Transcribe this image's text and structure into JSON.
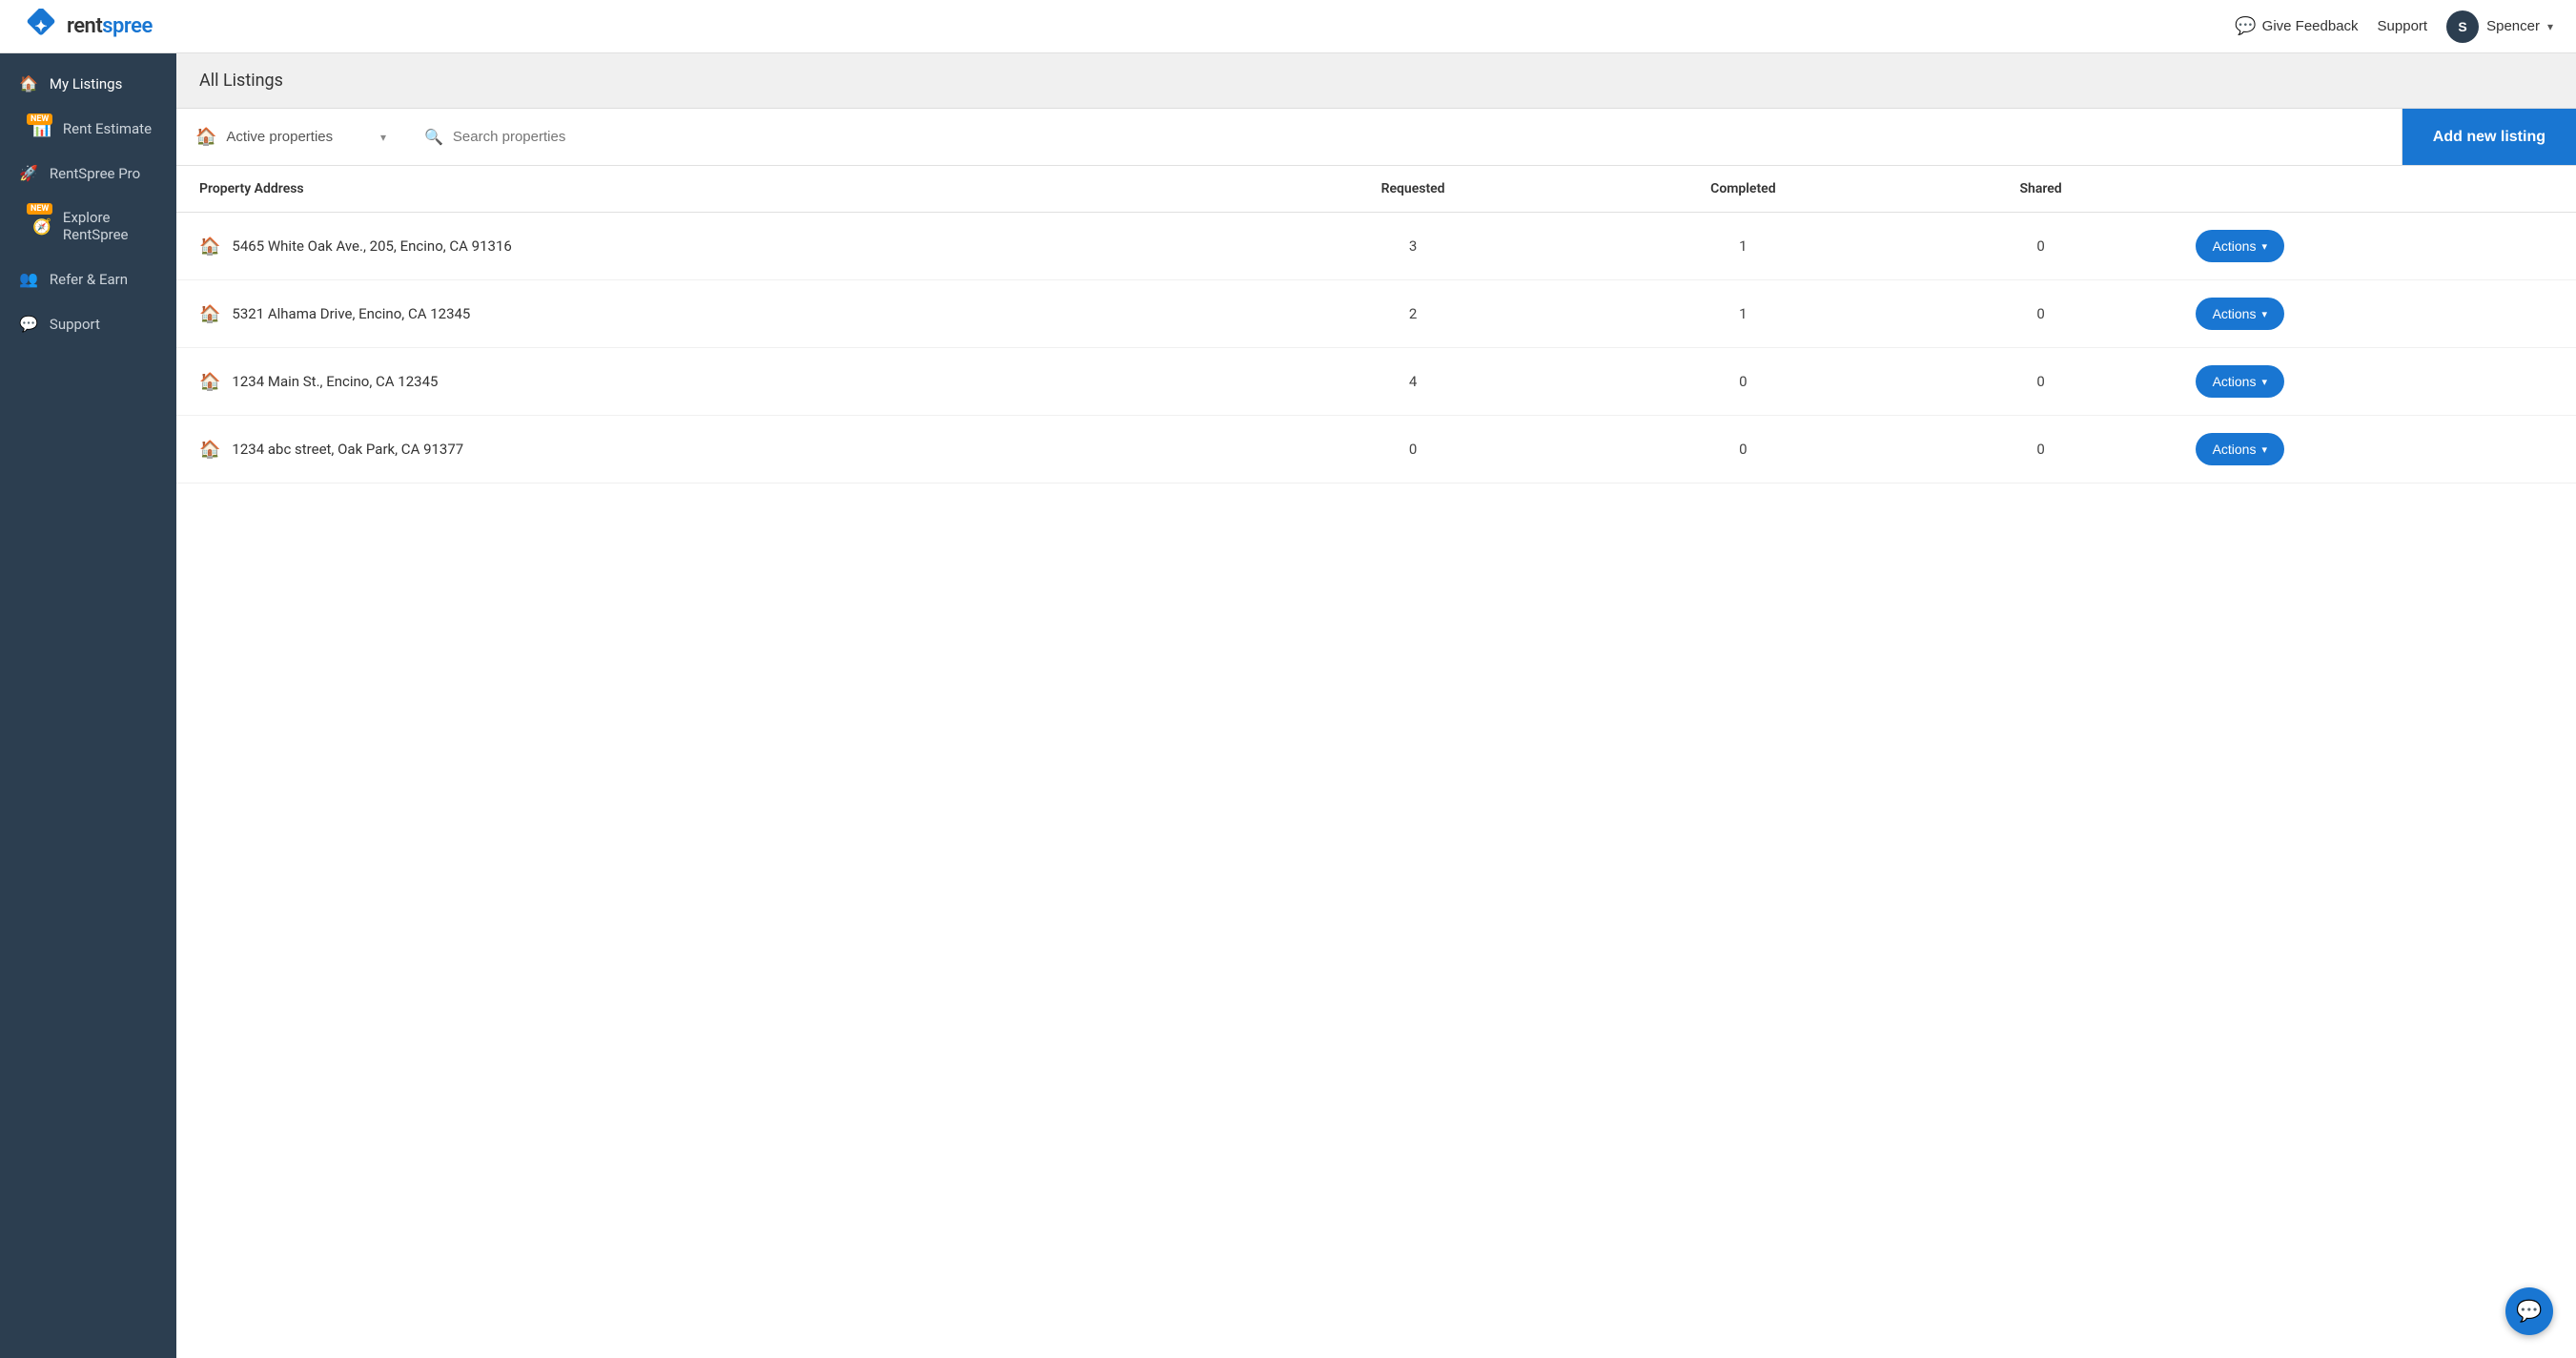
{
  "header": {
    "logo_text_rent": "rent",
    "logo_text_spree": "spree",
    "give_feedback_label": "Give Feedback",
    "support_label": "Support",
    "user_name": "Spencer",
    "user_initials": "S"
  },
  "sidebar": {
    "items": [
      {
        "id": "my-listings",
        "label": "My Listings",
        "icon": "🏠",
        "active": true,
        "new": false
      },
      {
        "id": "rent-estimate",
        "label": "Rent Estimate",
        "icon": "📊",
        "active": false,
        "new": true
      },
      {
        "id": "rentspree-pro",
        "label": "RentSpree Pro",
        "icon": "🚀",
        "active": false,
        "new": false
      },
      {
        "id": "explore-rentspree",
        "label": "Explore RentSpree",
        "icon": "🧭",
        "active": false,
        "new": true
      },
      {
        "id": "refer-earn",
        "label": "Refer & Earn",
        "icon": "👥",
        "active": false,
        "new": false
      },
      {
        "id": "support",
        "label": "Support",
        "icon": "💬",
        "active": false,
        "new": false
      }
    ]
  },
  "page": {
    "title": "All Listings"
  },
  "toolbar": {
    "filter_label": "Active properties",
    "search_placeholder": "Search properties",
    "add_listing_label": "Add new listing"
  },
  "table": {
    "columns": [
      {
        "key": "address",
        "label": "Property Address"
      },
      {
        "key": "requested",
        "label": "Requested"
      },
      {
        "key": "completed",
        "label": "Completed"
      },
      {
        "key": "shared",
        "label": "Shared"
      },
      {
        "key": "actions",
        "label": ""
      }
    ],
    "rows": [
      {
        "address": "5465 White Oak Ave., 205, Encino, CA 91316",
        "requested": "3",
        "completed": "1",
        "shared": "0",
        "actions_label": "Actions"
      },
      {
        "address": "5321 Alhama Drive, Encino, CA 12345",
        "requested": "2",
        "completed": "1",
        "shared": "0",
        "actions_label": "Actions"
      },
      {
        "address": "1234 Main St., Encino, CA 12345",
        "requested": "4",
        "completed": "0",
        "shared": "0",
        "actions_label": "Actions"
      },
      {
        "address": "1234 abc street, Oak Park, CA 91377",
        "requested": "0",
        "completed": "0",
        "shared": "0",
        "actions_label": "Actions"
      }
    ]
  },
  "colors": {
    "primary": "#1976d2",
    "sidebar_bg": "#2c3e50",
    "house_icon": "#4caf50",
    "new_badge": "#ff9800"
  }
}
